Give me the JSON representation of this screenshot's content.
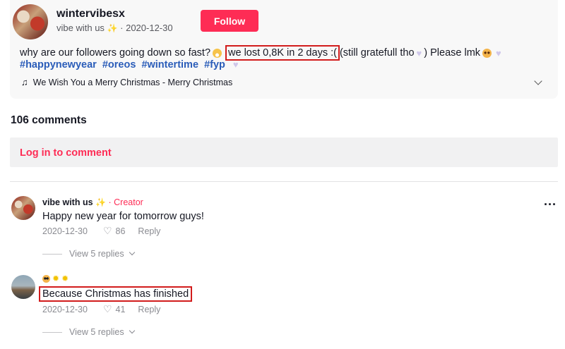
{
  "post": {
    "author": "wintervibesx",
    "sub_name": "vibe with us",
    "sub_separator": "·",
    "date": "2020-12-30",
    "follow_label": "Follow",
    "caption_part1": "why are our followers going down so fast?",
    "caption_highlight": "we lost 0,8K in 2 days :(",
    "caption_part2": "(still gratefull tho",
    "caption_part3": ") Please lmk",
    "hashtags": [
      "#happynewyear",
      "#oreos",
      "#wintertime",
      "#fyp"
    ],
    "music": "We Wish You a Merry Christmas - Merry Christmas",
    "music_icon": "music-note-icon"
  },
  "comments_header": "106 comments",
  "login": {
    "label": "Log in to comment"
  },
  "comments": [
    {
      "author": "vibe with us",
      "badge_separator": "·",
      "badge": "Creator",
      "text": "Happy new year for tomorrow guys!",
      "date": "2020-12-30",
      "likes": "86",
      "reply_label": "Reply",
      "view_replies": "View 5 replies"
    },
    {
      "author_emojis": [
        "sunglasses-emoji",
        "sun-emoji",
        "sun-emoji"
      ],
      "text": "Because Christmas has finished",
      "date": "2020-12-30",
      "likes": "41",
      "reply_label": "Reply",
      "view_replies": "View 5 replies"
    }
  ],
  "colors": {
    "accent": "#fe2c55",
    "hashtag": "#2b5db9",
    "highlight_box": "#d21c1c"
  }
}
